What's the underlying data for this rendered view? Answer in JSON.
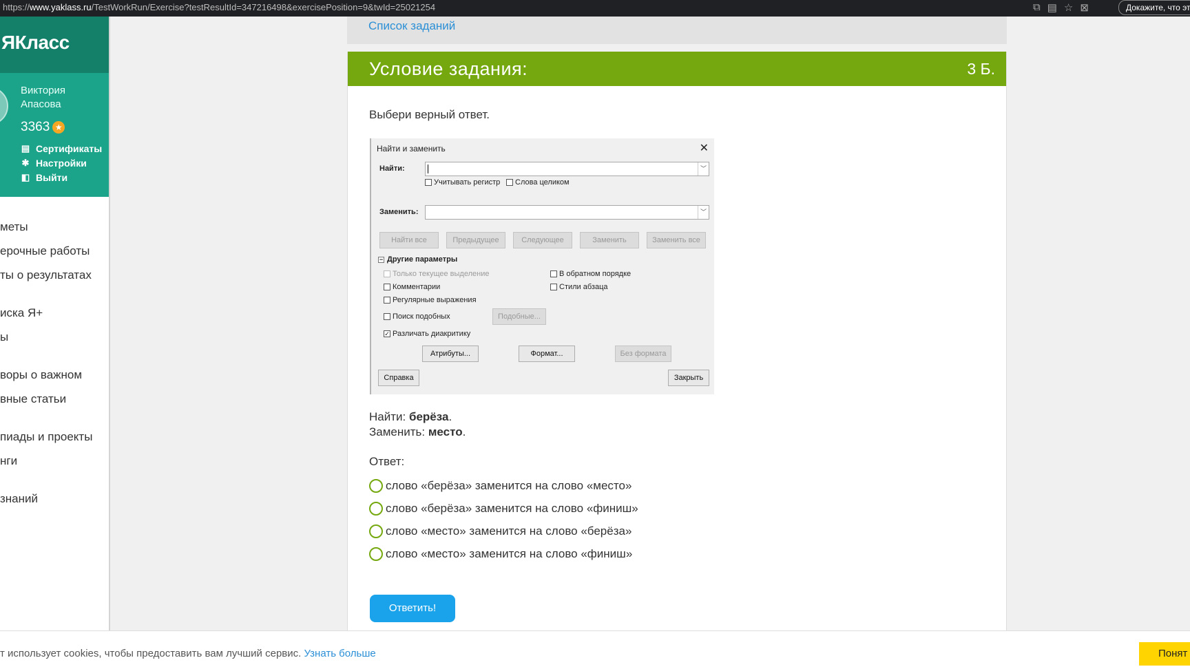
{
  "browser": {
    "url_prefix": "https://",
    "url_host": "www.yaklass.ru",
    "url_path": "/TestWorkRun/Exercise?testResultId=347216498&exercisePosition=9&twId=25021254",
    "pill_text": "Докажите, что эт"
  },
  "sidebar": {
    "logo": "ЯКласс",
    "user_name": "Виктория Апасова",
    "score": "3363",
    "links": [
      {
        "label": "Сертификаты",
        "icon": "certificate-icon"
      },
      {
        "label": "Настройки",
        "icon": "gear-icon"
      },
      {
        "label": "Выйти",
        "icon": "exit-icon"
      }
    ],
    "menu": [
      "меты",
      "ерочные работы",
      "ты о результатах",
      "иска Я+",
      "ы",
      "воры о важном",
      "вные статьи",
      "пиады и проекты",
      "нги",
      "знаний"
    ]
  },
  "breadcrumb": {
    "link": "Список заданий"
  },
  "task": {
    "title": "Условие задания:",
    "points": "3 Б.",
    "prompt": "Выбери верный ответ."
  },
  "dialog": {
    "title": "Найти и заменить",
    "find_label": "Найти:",
    "replace_label": "Заменить:",
    "chk_case": "Учитывать регистр",
    "chk_whole": "Слова целиком",
    "buttons_row": [
      "Найти все",
      "Предыдущее",
      "Следующее",
      "Заменить",
      "Заменить все"
    ],
    "section": "Другие параметры",
    "chk_selection": "Только текущее выделение",
    "chk_comments": "Комментарии",
    "chk_regex": "Регулярные выражения",
    "chk_similar": "Поиск подобных",
    "btn_similar": "Подобные...",
    "chk_diacritics": "Различать диакритику",
    "chk_reverse": "В обратном порядке",
    "chk_styles": "Стили абзаца",
    "btn_attributes": "Атрибуты...",
    "btn_format": "Формат...",
    "btn_noformat": "Без формата",
    "btn_help": "Справка",
    "btn_close": "Закрыть"
  },
  "find_line": {
    "label": "Найти: ",
    "value": "берёза",
    "end": "."
  },
  "replace_line": {
    "label": "Заменить: ",
    "value": "место",
    "end": "."
  },
  "answer_label": "Ответ:",
  "options": [
    "слово «берёза» заменится на слово «место»",
    "слово «берёза» заменится на слово «финиш»",
    "слово «место» заменится на слово «берёза»",
    "слово «место» заменится на слово «финиш»"
  ],
  "submit_label": "Ответить!",
  "cookie": {
    "text": "т использует cookies, чтобы предоставить вам лучший сервис. ",
    "link": "Узнать больше",
    "button": "Понят"
  },
  "colors": {
    "accent_green": "#75a80e",
    "brand_teal": "#14806a",
    "button_blue": "#1aa3ea",
    "cookie_yellow": "#ffd400"
  }
}
